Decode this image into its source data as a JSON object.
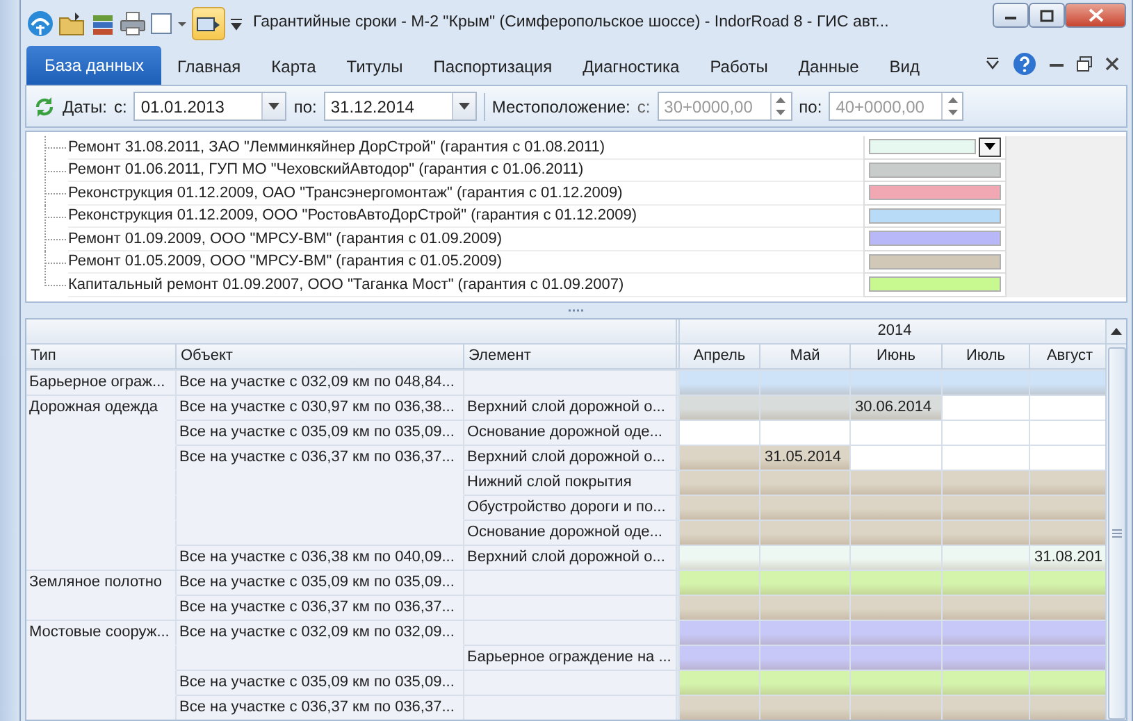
{
  "window": {
    "title": "Гарантийные сроки - М-2 \"Крым\" (Симферопольское шоссе) - IndorRoad 8 - ГИС авт..."
  },
  "ribbon_tabs": [
    {
      "label": "База данных",
      "selected": true
    },
    {
      "label": "Главная",
      "selected": false
    },
    {
      "label": "Карта",
      "selected": false
    },
    {
      "label": "Титулы",
      "selected": false
    },
    {
      "label": "Паспортизация",
      "selected": false
    },
    {
      "label": "Диагностика",
      "selected": false
    },
    {
      "label": "Работы",
      "selected": false
    },
    {
      "label": "Данные",
      "selected": false
    },
    {
      "label": "Вид",
      "selected": false
    }
  ],
  "filter": {
    "dates_label": "Даты:",
    "from_label": "с:",
    "from_value": "01.01.2013",
    "to_label": "по:",
    "to_value": "31.12.2014",
    "location_label": "Местоположение:",
    "loc_from_label": "с:",
    "loc_from_value": "30+0000,00",
    "loc_to_label": "по:",
    "loc_to_value": "40+0000,00",
    "location_disabled": true
  },
  "legend": [
    {
      "text": "Ремонт 31.08.2011, ЗАО \"Лемминкяйнер ДорСтрой\" (гарантия с 01.08.2011)",
      "color": "#e6f8f0",
      "editing": true
    },
    {
      "text": "Ремонт 01.06.2011, ГУП МО \"ЧеховскийАвтодор\" (гарантия с 01.06.2011)",
      "color": "#c8cdcc",
      "editing": false
    },
    {
      "text": "Реконструкция 01.12.2009, ОАО \"Трансэнергомонтаж\" (гарантия с 01.12.2009)",
      "color": "#f2a8b2",
      "editing": false
    },
    {
      "text": "Реконструкция 01.12.2009, ООО \"РостовАвтоДорСтрой\" (гарантия с 01.12.2009)",
      "color": "#b8dcf8",
      "editing": false
    },
    {
      "text": "Ремонт 01.09.2009, ООО \"МРСУ-ВМ\" (гарантия с 01.09.2009)",
      "color": "#b8b8f8",
      "editing": false
    },
    {
      "text": "Ремонт 01.05.2009, ООО \"МРСУ-ВМ\" (гарантия с 01.05.2009)",
      "color": "#d2c8b8",
      "editing": false
    },
    {
      "text": "Капитальный ремонт 01.09.2007, ООО \"Таганка Мост\" (гарантия с 01.09.2007)",
      "color": "#c8f890",
      "editing": false
    }
  ],
  "grid": {
    "columns": [
      "Тип",
      "Объект",
      "Элемент"
    ],
    "year": "2014",
    "months": [
      "Апрель",
      "Май",
      "Июнь",
      "Июль",
      "Август"
    ],
    "rows": [
      {
        "type": "Барьерное ограж...",
        "object": "Все на участке с 032,09 км по 048,84...",
        "color": "#cfe3f8",
        "cells": [
          {
            "filled": true
          },
          {
            "filled": true
          },
          {
            "filled": true
          },
          {
            "filled": true
          },
          {
            "filled": true
          }
        ]
      },
      {
        "type": "Дорожная одежда",
        "object": "Все на участке с 030,97 км по 036,38...",
        "element": "Верхний слой дорожной о...",
        "color": "#d8dcda",
        "cells": [
          {
            "filled": true
          },
          {
            "filled": true
          },
          {
            "filled": true,
            "text": "30.06.2014"
          },
          {
            "filled": false
          },
          {
            "filled": false
          }
        ]
      },
      {
        "object": "Все на участке с 035,09 км по 035,09...",
        "element": "Основание дорожной оде..."
      },
      {
        "object": "Все на участке с 036,37 км по 036,37...",
        "element": "Верхний слой дорожной о...",
        "color": "#dcd4c4",
        "cells": [
          {
            "filled": true
          },
          {
            "filled": true,
            "text": "31.05.2014"
          },
          {
            "filled": false
          },
          {
            "filled": false
          },
          {
            "filled": false
          }
        ]
      },
      {
        "element": "Нижний слой покрытия",
        "color": "#dcd4c4",
        "cells": [
          {
            "filled": true
          },
          {
            "filled": true
          },
          {
            "filled": true
          },
          {
            "filled": true
          },
          {
            "filled": true
          }
        ]
      },
      {
        "element": "Обустройство дороги и по...",
        "color": "#dcd4c4",
        "cells": [
          {
            "filled": true
          },
          {
            "filled": true
          },
          {
            "filled": true
          },
          {
            "filled": true
          },
          {
            "filled": true
          }
        ]
      },
      {
        "element": "Основание дорожной оде...",
        "color": "#dcd4c4",
        "cells": [
          {
            "filled": true
          },
          {
            "filled": true
          },
          {
            "filled": true
          },
          {
            "filled": true
          },
          {
            "filled": true
          }
        ]
      },
      {
        "object": "Все на участке с 036,38 км по 040,09...",
        "element": "Верхний слой дорожной о...",
        "color": "#eef8f2",
        "cells": [
          {
            "filled": true
          },
          {
            "filled": true
          },
          {
            "filled": true
          },
          {
            "filled": true
          },
          {
            "filled": true,
            "text": "31.08.201"
          }
        ]
      },
      {
        "type": "Земляное полотно",
        "object": "Все на участке с 035,09 км по 035,09...",
        "color": "#d4f4ac",
        "cells": [
          {
            "filled": true
          },
          {
            "filled": true
          },
          {
            "filled": true
          },
          {
            "filled": true
          },
          {
            "filled": true
          }
        ]
      },
      {
        "object": "Все на участке с 036,37 км по 036,37...",
        "color": "#dcd4c4",
        "cells": [
          {
            "filled": true
          },
          {
            "filled": true
          },
          {
            "filled": true
          },
          {
            "filled": true
          },
          {
            "filled": true
          }
        ]
      },
      {
        "type": "Мостовые сооруж...",
        "object": "Все на участке с 032,09 км по 032,09...",
        "color": "#c8c8f8",
        "cells": [
          {
            "filled": true
          },
          {
            "filled": true
          },
          {
            "filled": true
          },
          {
            "filled": true
          },
          {
            "filled": true
          }
        ]
      },
      {
        "element": "Барьерное ограждение на ...",
        "color": "#c8c8f8",
        "cells": [
          {
            "filled": true
          },
          {
            "filled": true
          },
          {
            "filled": true
          },
          {
            "filled": true
          },
          {
            "filled": true
          }
        ]
      },
      {
        "object": "Все на участке с 035,09 км по 035,09...",
        "color": "#d4f4ac",
        "cells": [
          {
            "filled": true
          },
          {
            "filled": true
          },
          {
            "filled": true
          },
          {
            "filled": true
          },
          {
            "filled": true
          }
        ]
      },
      {
        "object": "Все на участке с 036,37 км по 036,37...",
        "color": "#dcd4c4",
        "cells": [
          {
            "filled": true
          },
          {
            "filled": true
          },
          {
            "filled": true
          },
          {
            "filled": true
          },
          {
            "filled": true
          }
        ]
      }
    ]
  }
}
